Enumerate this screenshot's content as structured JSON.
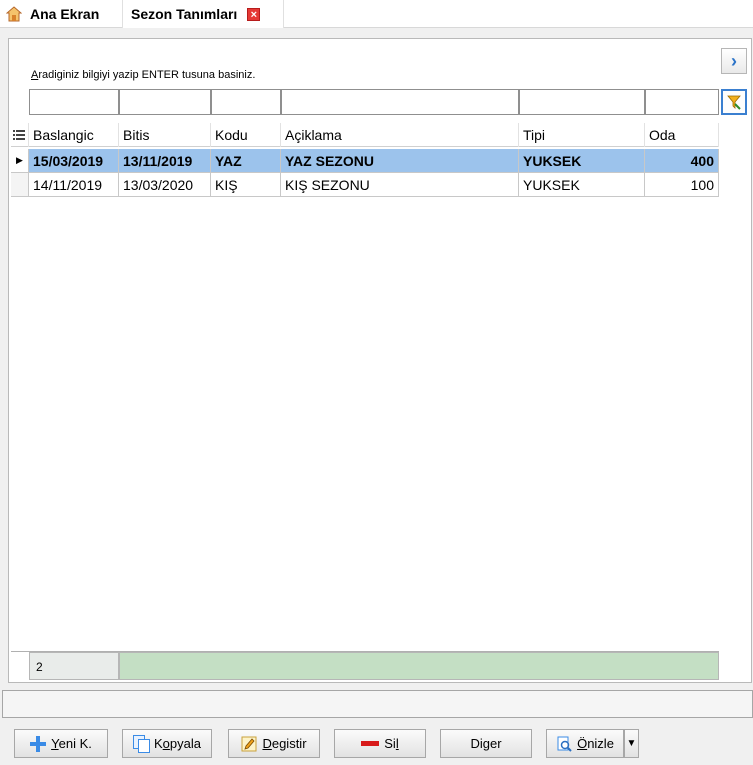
{
  "tabs": {
    "home_label": "Ana Ekran",
    "active_label": "Sezon Tanımları",
    "close_glyph": "×"
  },
  "search": {
    "hint_first": "A",
    "hint_rest": "radiginiz bilgiyi yazip ENTER tusuna basiniz."
  },
  "nav": {
    "next_glyph": "›"
  },
  "grid": {
    "columns": [
      "Baslangic",
      "Bitis",
      "Kodu",
      "Açiklama",
      "Tipi",
      "Oda"
    ],
    "rows": [
      {
        "baslangic": "15/03/2019",
        "bitis": "13/11/2019",
        "kodu": "YAZ",
        "aciklama": "YAZ SEZONU",
        "tipi": "YUKSEK",
        "oda": "400"
      },
      {
        "baslangic": "14/11/2019",
        "bitis": "13/03/2020",
        "kodu": "KIŞ",
        "aciklama": "KIŞ SEZONU",
        "tipi": "YUKSEK",
        "oda": "100"
      }
    ],
    "record_count": "2"
  },
  "buttons": {
    "new": {
      "key": "Y",
      "rest": "eni K."
    },
    "copy": {
      "pre": "K",
      "key": "o",
      "rest": "pyala"
    },
    "edit": {
      "key": "D",
      "rest": "egistir"
    },
    "delete": {
      "pre": "Si",
      "key": "l",
      "rest": ""
    },
    "other": {
      "pre": "Di",
      "key": "g",
      "rest": "er"
    },
    "preview": {
      "key": "Ö",
      "rest": "nizle"
    }
  },
  "colors": {
    "selected_row": "#9cc3ec",
    "summary_bar": "#c4dfc4",
    "accent": "#3a8be6",
    "close": "#e53935"
  }
}
